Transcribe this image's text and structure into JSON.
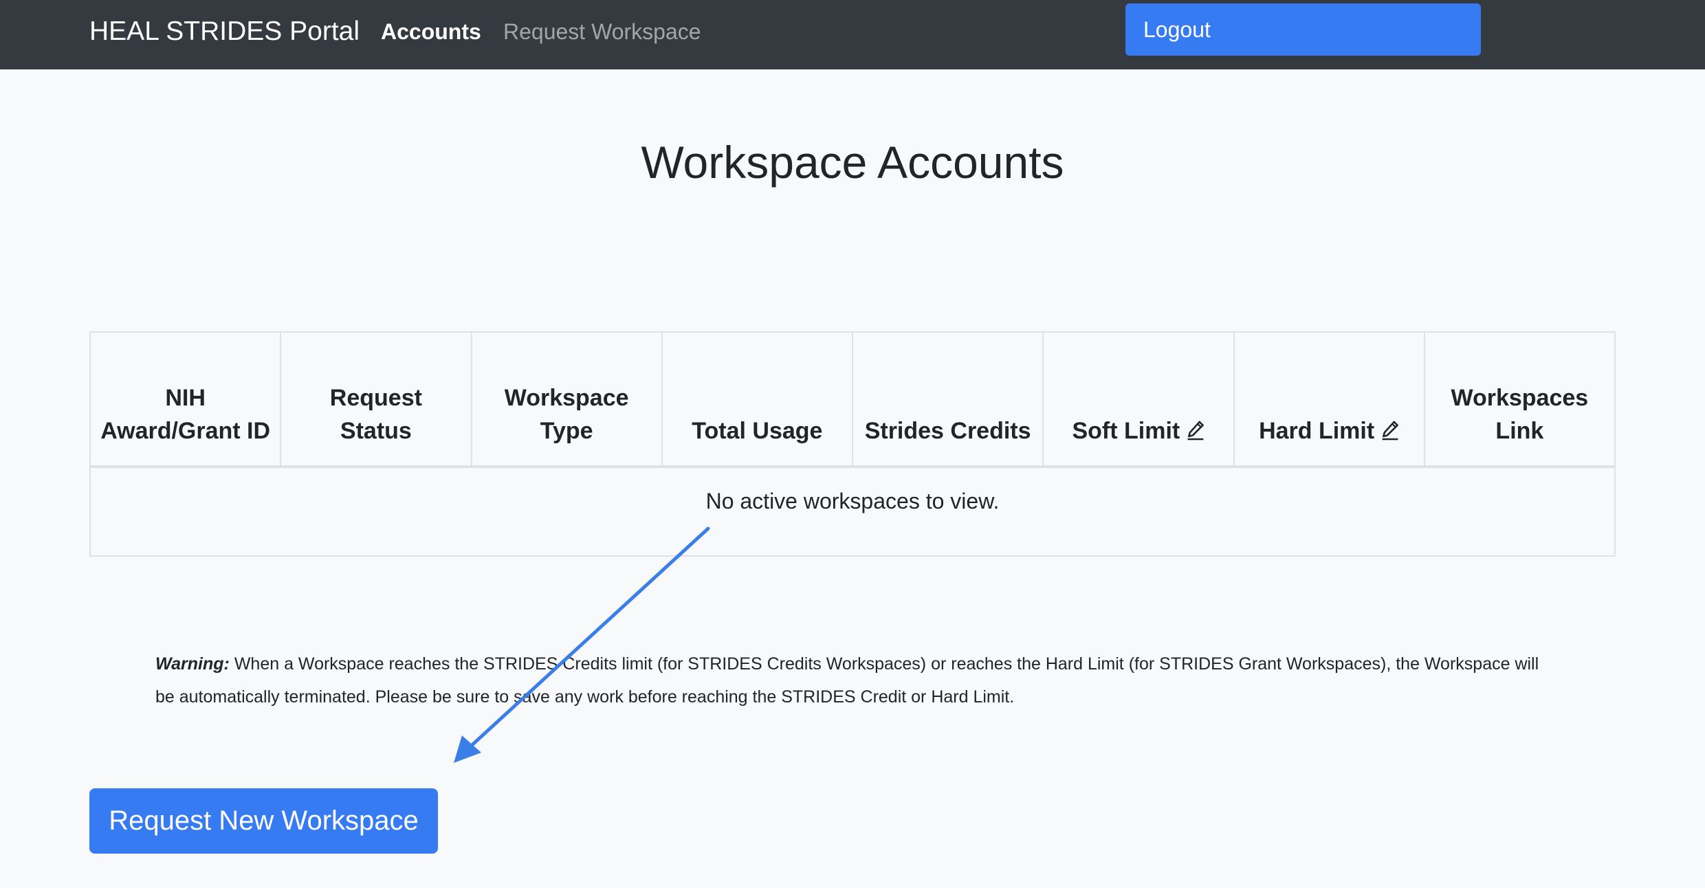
{
  "navbar": {
    "brand": "HEAL STRIDES Portal",
    "links": [
      {
        "label": "Accounts",
        "active": true
      },
      {
        "label": "Request Workspace",
        "active": false
      }
    ],
    "logout_label": "Logout"
  },
  "page": {
    "title": "Workspace Accounts"
  },
  "table": {
    "columns": [
      {
        "label": "NIH Award/Grant ID",
        "editable": false
      },
      {
        "label": "Request Status",
        "editable": false
      },
      {
        "label": "Workspace Type",
        "editable": false
      },
      {
        "label": "Total Usage",
        "editable": false
      },
      {
        "label": "Strides Credits",
        "editable": false
      },
      {
        "label": "Soft Limit",
        "editable": true,
        "icon": "pencil-icon"
      },
      {
        "label": "Hard Limit",
        "editable": true,
        "icon": "pencil-icon"
      },
      {
        "label": "Workspaces Link",
        "editable": false
      }
    ],
    "rows": [],
    "empty_message": "No active workspaces to view."
  },
  "warning": {
    "label": "Warning:",
    "text": " When a Workspace reaches the STRIDES Credits limit (for STRIDES Credits Workspaces) or reaches the Hard Limit (for STRIDES Grant Workspaces), the Workspace will be automatically terminated. Please be sure to save any work before reaching the STRIDES Credit or Hard Limit."
  },
  "actions": {
    "request_new_workspace_label": "Request New Workspace"
  },
  "annotation": {
    "type": "arrow",
    "color": "#3a7ee8",
    "points_to": "request-new-workspace-button"
  },
  "colors": {
    "navbar_bg": "#343a40",
    "primary": "#377bf3",
    "page_bg": "#f8f9fa",
    "border": "#dee2e6"
  }
}
